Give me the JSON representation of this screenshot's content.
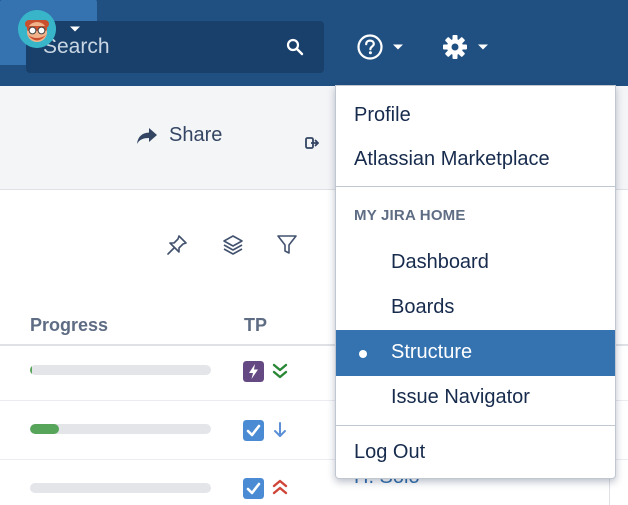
{
  "header": {
    "search_placeholder": "Search",
    "brand_color": "#205081",
    "icons": [
      "search-icon",
      "help-icon",
      "gear-icon",
      "avatar"
    ]
  },
  "toolbar": {
    "share_label": "Share"
  },
  "table": {
    "columns": [
      "Progress",
      "TP"
    ],
    "rows": [
      {
        "progress": 0.01,
        "type": "epic",
        "priority": "lowest"
      },
      {
        "progress": 0.16,
        "type": "task",
        "priority": "low"
      },
      {
        "progress": 0.0,
        "type": "task",
        "priority": "highest",
        "assignee": "H. Solo"
      }
    ]
  },
  "dropdown": {
    "items_top": [
      "Profile",
      "Atlassian Marketplace"
    ],
    "section_heading": "MY JIRA HOME",
    "home_items": [
      "Dashboard",
      "Boards",
      "Structure",
      "Issue Navigator"
    ],
    "active_item": "Structure",
    "logout": "Log Out"
  }
}
